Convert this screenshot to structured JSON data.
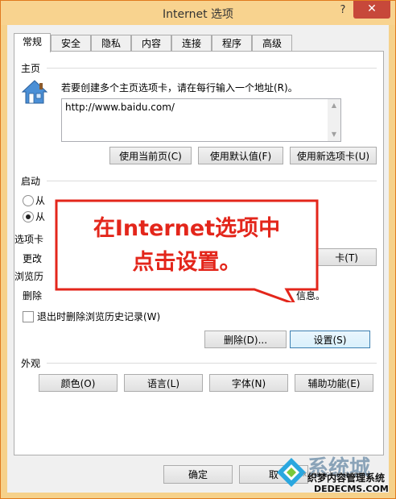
{
  "window": {
    "title": "Internet 选项",
    "help": "?",
    "close": "✕"
  },
  "tabs": [
    "常规",
    "安全",
    "隐私",
    "内容",
    "连接",
    "程序",
    "高级"
  ],
  "homepage": {
    "label": "主页",
    "hint": "若要创建多个主页选项卡，请在每行输入一个地址(R)。",
    "url": "http://www.baidu.com/",
    "buttons": [
      "使用当前页(C)",
      "使用默认值(F)",
      "使用新选项卡(U)"
    ]
  },
  "startup": {
    "label": "启动",
    "option1": "从上次会话中的选项卡开始(B)",
    "option1_visible": "从",
    "option2_visible": "从"
  },
  "tabs_group": {
    "label_visible": "选项卡",
    "change_visible": "更改",
    "button_visible": "卡(T)"
  },
  "history": {
    "label_visible": "浏览历",
    "delete_visible": "删除",
    "delete_tail_visible": "信息。",
    "checkbox": "退出时删除浏览历史记录(W)",
    "delete_button": "删除(D)...",
    "settings_button": "设置(S)"
  },
  "appearance": {
    "label": "外观",
    "buttons": [
      "颜色(O)",
      "语言(L)",
      "字体(N)",
      "辅助功能(E)"
    ]
  },
  "callout": {
    "line1": "在Internet选项中",
    "line2": "点击设置。"
  },
  "footer": {
    "ok": "确定",
    "cancel_visible": "取"
  },
  "watermark": {
    "big": "系统城",
    "mid": "xitongcheng.com",
    "line1": "织梦内容管理系统",
    "line2": "DEDECMS.COM"
  },
  "colors": {
    "accent": "#e3261b",
    "title_bar": "#f8d38f",
    "close": "#c7483a"
  }
}
